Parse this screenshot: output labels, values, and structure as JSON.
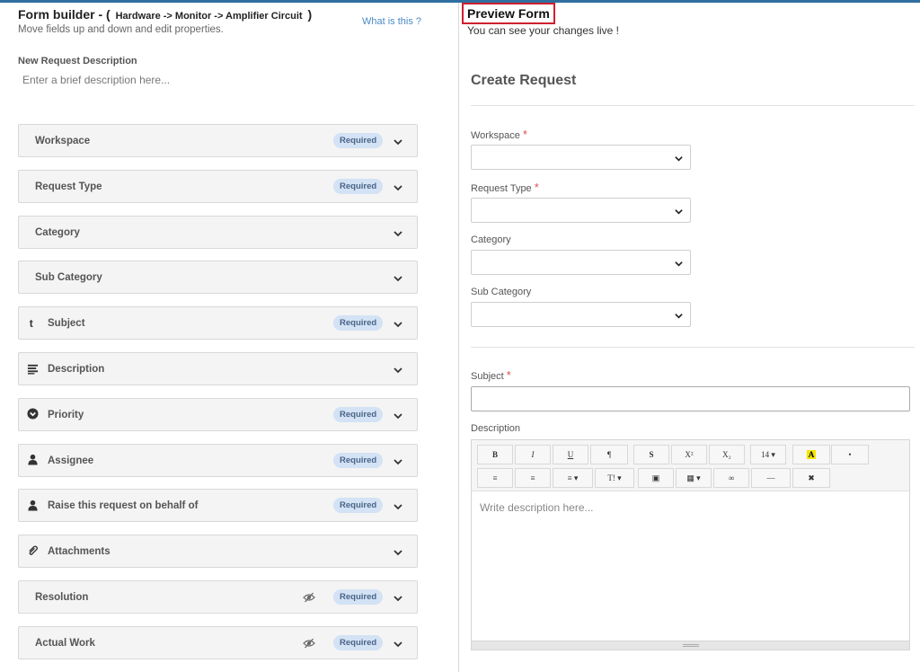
{
  "builder": {
    "title": "Form builder -",
    "path_open": "(",
    "path": "Hardware -> Monitor -> Amplifier Circuit",
    "path_close": ")",
    "subtitle": "Move fields up and down and edit properties.",
    "help_link": "What is this ?",
    "request_description_label": "New Request Description",
    "request_description_placeholder": "Enter a brief description here...",
    "fields": [
      {
        "label": "Workspace",
        "icon": "",
        "required": "Required",
        "hidden_icon": ""
      },
      {
        "label": "Request Type",
        "icon": "",
        "required": "Required",
        "hidden_icon": ""
      },
      {
        "label": "Category",
        "icon": "",
        "required": "",
        "hidden_icon": ""
      },
      {
        "label": "Sub Category",
        "icon": "",
        "required": "",
        "hidden_icon": ""
      },
      {
        "label": "Subject",
        "icon": "t-icon",
        "required": "Required",
        "hidden_icon": ""
      },
      {
        "label": "Description",
        "icon": "align-left-icon",
        "required": "",
        "hidden_icon": ""
      },
      {
        "label": "Priority",
        "icon": "chevron-circle-down-icon",
        "required": "Required",
        "hidden_icon": ""
      },
      {
        "label": "Assignee",
        "icon": "user-icon",
        "required": "Required",
        "hidden_icon": ""
      },
      {
        "label": "Raise this request on behalf of",
        "icon": "user-icon",
        "required": "Required",
        "hidden_icon": ""
      },
      {
        "label": "Attachments",
        "icon": "paperclip-icon",
        "required": "",
        "hidden_icon": ""
      },
      {
        "label": "Resolution",
        "icon": "",
        "required": "Required",
        "hidden_icon": "eye-slash-icon"
      },
      {
        "label": "Actual Work",
        "icon": "",
        "required": "Required",
        "hidden_icon": "eye-slash-icon"
      }
    ]
  },
  "preview": {
    "title": "Preview Form",
    "subtitle": "You can see your changes live !",
    "form_title": "Create Request",
    "workspace_label": "Workspace",
    "request_type_label": "Request Type",
    "category_label": "Category",
    "sub_category_label": "Sub Category",
    "subject_label": "Subject",
    "description_label": "Description",
    "required_mark": "*",
    "editor_placeholder": "Write description here...",
    "toolbar_row1": [
      "B",
      "I",
      "U",
      "¶",
      "S",
      "X²",
      "X₂",
      "14 ▾",
      "A",
      "•"
    ],
    "toolbar_row2": [
      "≡",
      "≡",
      "≡ ▾",
      "T! ▾",
      "▣",
      "▦ ▾",
      "∞",
      "—",
      "✖"
    ]
  },
  "colors": {
    "accent_bar": "#2f6f9f",
    "required_badge_bg": "#d3e2f4",
    "required_star": "#d9534f",
    "preview_highlight": "#d01f2f",
    "link": "#4b8ac6"
  }
}
